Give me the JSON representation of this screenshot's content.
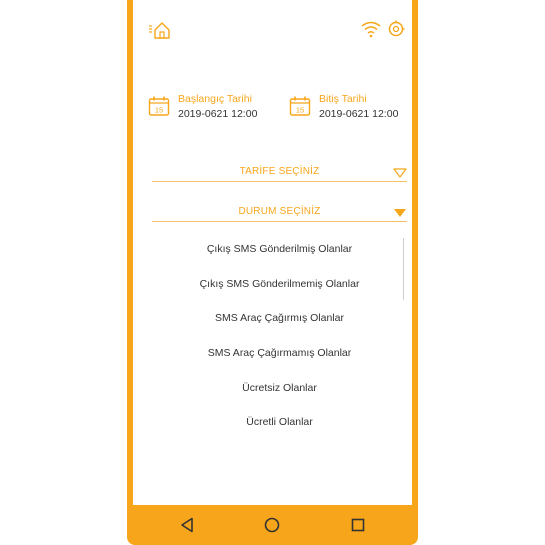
{
  "status_bar": {
    "home_icon": "home-outline-icon",
    "wifi_icon": "wifi-icon",
    "settings_icon": "settings-icon"
  },
  "dates": {
    "start": {
      "label": "Başlangıç Tarihi",
      "value": "2019-0621 12:00",
      "icon": "calendar-icon"
    },
    "end": {
      "label": "Bitiş Tarihi",
      "value": "2019-0621 12:00",
      "icon": "calendar-icon"
    }
  },
  "tariff_select": {
    "label": "TARİFE SEÇİNİZ",
    "state": "collapsed"
  },
  "status_select": {
    "label": "DURUM SEÇİNİZ",
    "state": "expanded",
    "options": [
      "Çıkış SMS Gönderilmiş Olanlar",
      "Çıkış SMS Gönderilmemiş Olanlar",
      "SMS Araç Çağırmış Olanlar",
      "SMS Araç Çağırmamış Olanlar",
      "Ücretsiz Olanlar",
      "Ücretli Olanlar"
    ]
  },
  "nav": {
    "back_icon": "back-triangle-icon",
    "home_icon": "home-circle-icon",
    "recents_icon": "recents-square-icon"
  },
  "colors": {
    "accent": "#f7a61b",
    "text": "#333333",
    "background": "#ffffff"
  }
}
